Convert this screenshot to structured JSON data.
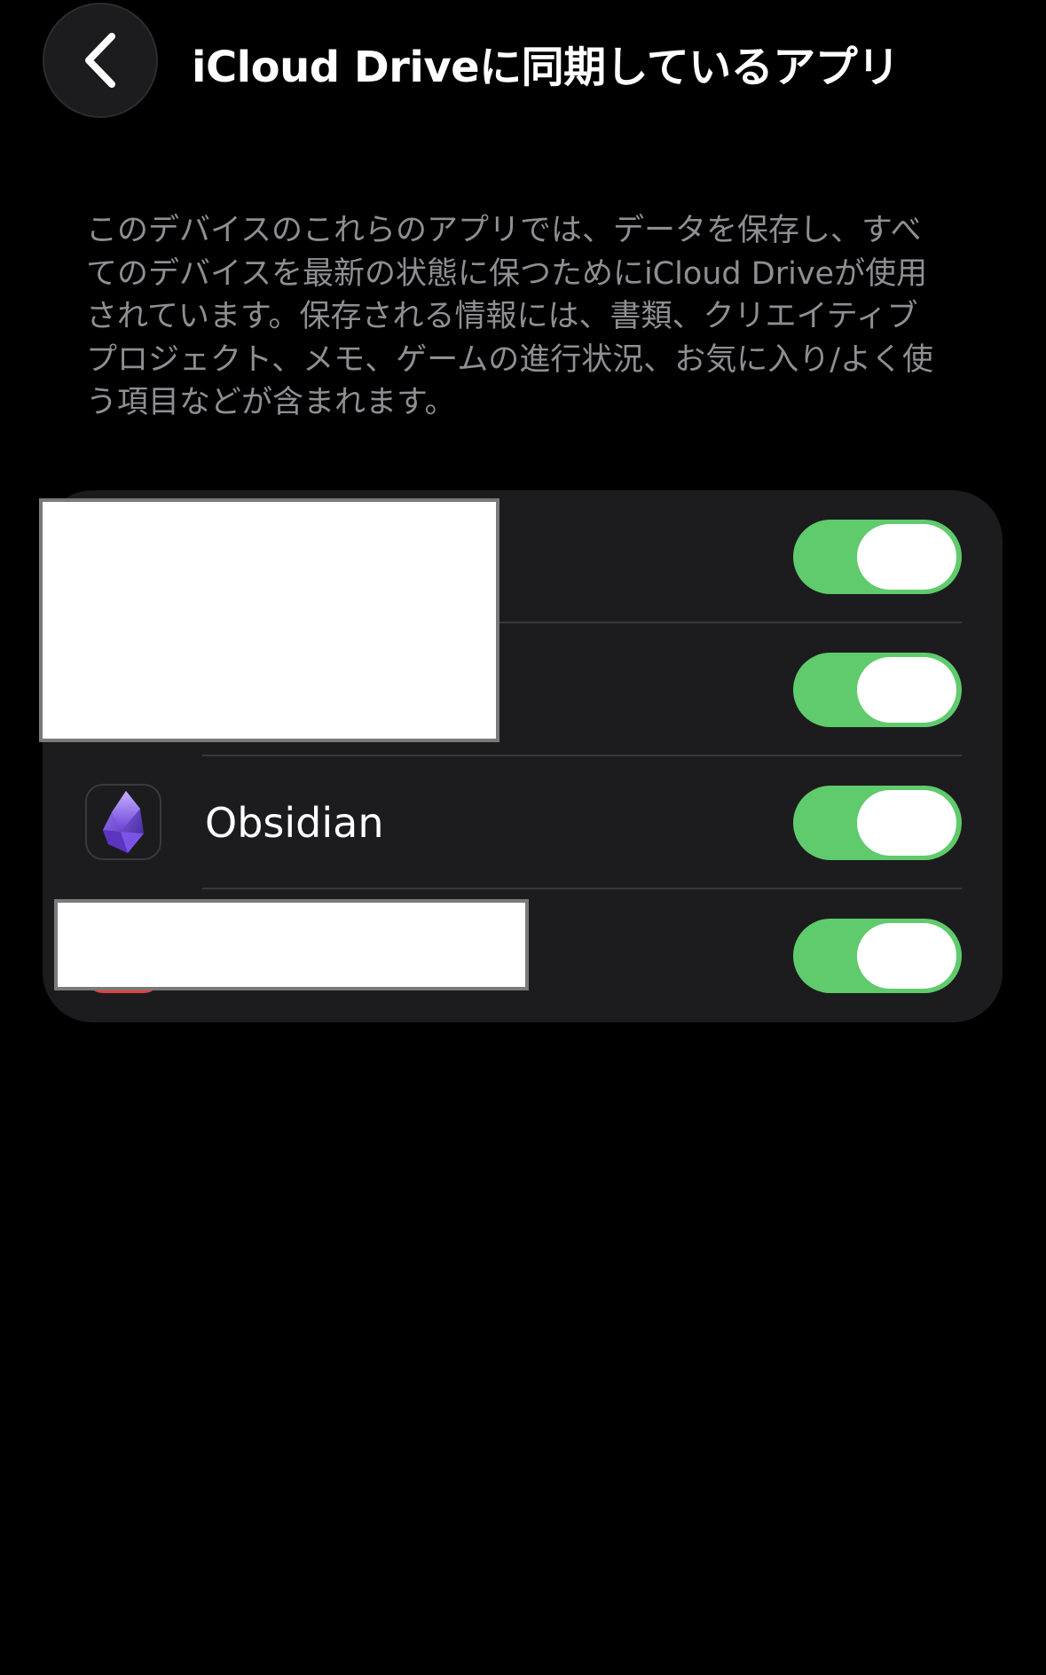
{
  "header": {
    "back_icon": "chevron-left-icon",
    "title": "iCloud Driveに同期しているアプリ"
  },
  "description": "このデバイスのこれらのアプリでは、データを保存し、すべてのデバイスを最新の状態に保つためにiCloud Driveが使用されています。保存される情報には、書類、クリエイティブプロジェクト、メモ、ゲームの進行状況、お気に入り/よく使う項目などが含まれます。",
  "apps": [
    {
      "name": "",
      "icon": "redacted",
      "sync_enabled": true
    },
    {
      "name": "",
      "icon": "redacted",
      "sync_enabled": true
    },
    {
      "name": "Obsidian",
      "icon": "obsidian-icon",
      "sync_enabled": true
    },
    {
      "name": "",
      "icon": "red-app-icon",
      "sync_enabled": true
    }
  ],
  "colors": {
    "background": "#000000",
    "card": "#1c1c1e",
    "toggle_on": "#5fcb6c",
    "secondary_text": "#8e8e93",
    "obsidian_purple": "#7c5cdc"
  }
}
